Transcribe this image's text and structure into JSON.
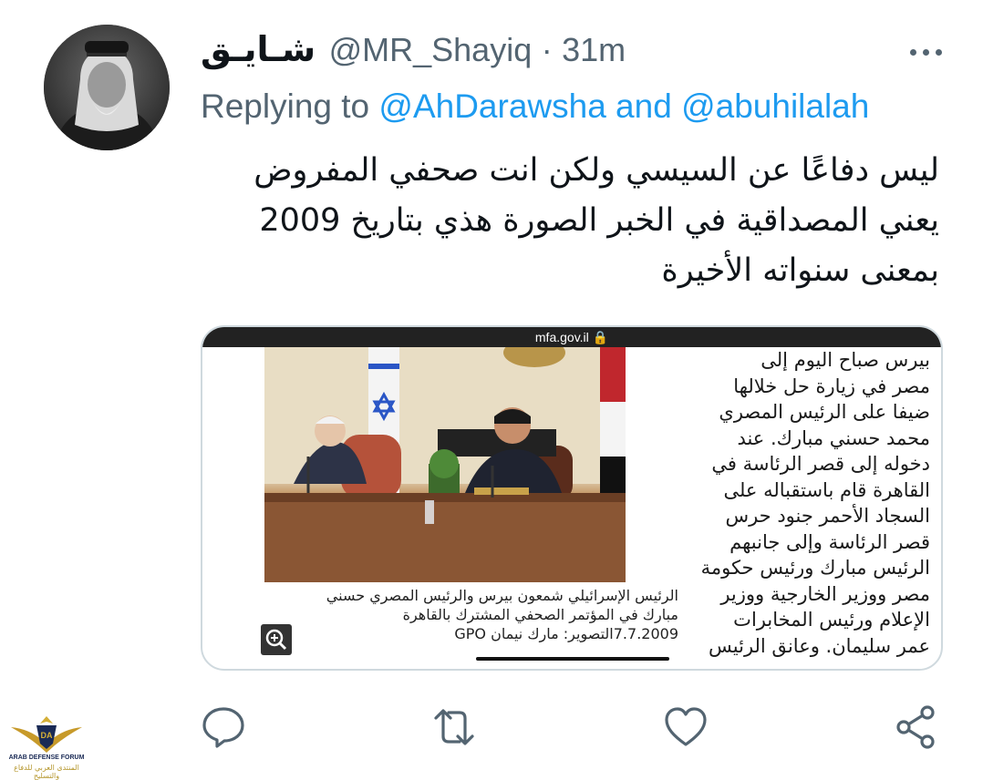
{
  "tweet": {
    "display_name": "شـايـق",
    "handle": "@MR_Shayiq",
    "separator": "·",
    "time": "31m",
    "replying_prefix": "Replying to",
    "replying_to": "@AhDarawsha and @abuhilalah",
    "text_lines": [
      "ليس دفاعًا عن السيسي ولكن انت صحفي المفروض",
      "يعني المصداقية في الخبر الصورة هذي بتاريخ 2009",
      "بمعنى سنواته الأخيرة"
    ]
  },
  "media": {
    "url": "mfa.gov.il 🔒",
    "article_lines": [
      "بيرس صباح اليوم إلى",
      "مصر في زيارة حل خلالها",
      "ضيفا على الرئيس المصري",
      "محمد حسني مبارك. عند",
      "دخوله إلى قصر الرئاسة في",
      "القاهرة قام باستقباله على",
      "السجاد الأحمر جنود حرس",
      "قصر الرئاسة وإلى جانبهم",
      "الرئيس مبارك ورئيس حكومة",
      "مصر ووزير الخارجية ووزير",
      "الإعلام ورئيس المخابرات",
      "عمر سليمان. وعانق الرئيس"
    ],
    "caption_lines": [
      "الرئيس الإسرائيلي شمعون بيرس والرئيس المصري حسني",
      "مبارك في المؤتمر الصحفي المشترك بالقاهرة",
      "7.7.2009التصوير: مارك نيمان GPO"
    ]
  },
  "watermark": {
    "line1": "ARAB DEFENSE FORUM",
    "line2": "المنتدى العربي للدفاع والتسليح",
    "monogram": "DA"
  },
  "colors": {
    "link": "#1d9bf0",
    "secondary_text": "#536471",
    "border": "#cfd9de"
  }
}
